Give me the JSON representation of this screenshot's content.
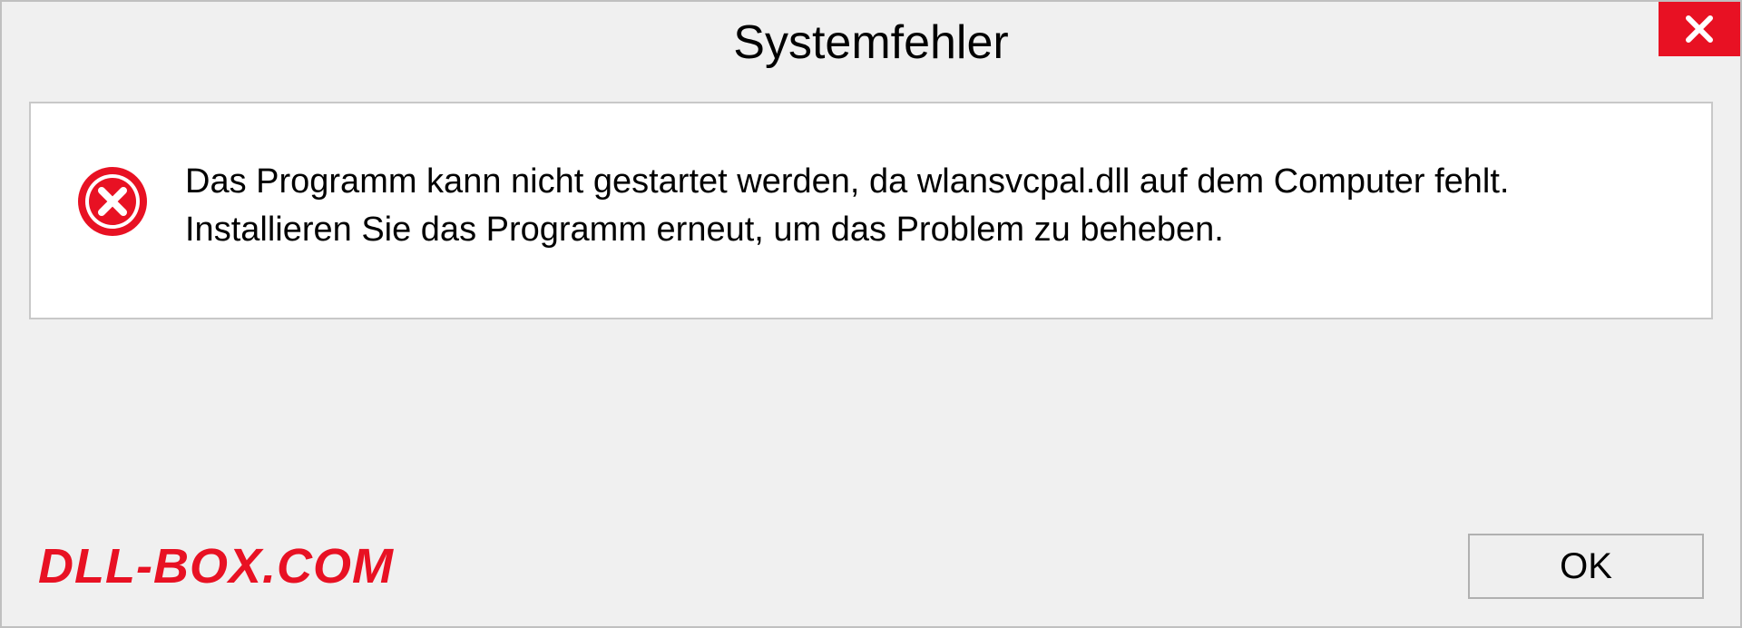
{
  "dialog": {
    "title": "Systemfehler",
    "message": "Das Programm kann nicht gestartet werden, da wlansvcpal.dll auf dem Computer fehlt. Installieren Sie das Programm erneut, um das Problem zu beheben.",
    "ok_label": "OK",
    "watermark": "DLL-BOX.COM"
  }
}
